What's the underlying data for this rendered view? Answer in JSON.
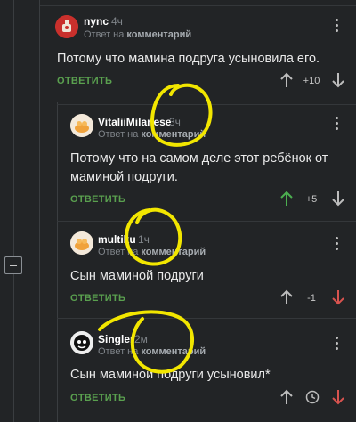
{
  "comments": [
    {
      "author": "nync",
      "time": "4ч",
      "reply_prefix": "Ответ на",
      "reply_target": "комментарий",
      "text": "Потому что мамина подруга усыновила его.",
      "answer_label": "ОТВЕТИТЬ",
      "score": "+10",
      "vote_state": "none"
    },
    {
      "author": "VitaliiMilanese",
      "time": "3ч",
      "reply_prefix": "Ответ на",
      "reply_target": "комментарий",
      "text_line1": "Потому что на самом деле этот ребёнок от",
      "text_line2": "маминой подруги.",
      "answer_label": "ОТВЕТИТЬ",
      "score": "+5",
      "vote_state": "up"
    },
    {
      "author": "multiku",
      "time": "1ч",
      "reply_prefix": "Ответ на",
      "reply_target": "комментарий",
      "text": "Сын маминой подруги",
      "answer_label": "ОТВЕТИТЬ",
      "score": "-1",
      "vote_state": "down"
    },
    {
      "author": "Singler",
      "time": "2м",
      "reply_prefix": "Ответ на",
      "reply_target": "комментарий",
      "text": "Сын маминой подруги усыновил*",
      "answer_label": "ОТВЕТИТЬ",
      "vote_state": "down"
    }
  ],
  "colors": {
    "background": "#222426",
    "answer_green": "#5aa04f",
    "upvote_green": "#4caf50",
    "downvote_red": "#d9534f",
    "highlight_yellow": "#f2e600"
  },
  "icons": {
    "upvote": "arrow-up-icon",
    "downvote": "arrow-down-icon",
    "menu": "more-vertical-icon",
    "pending": "clock-icon",
    "collapse": "collapse-minus-icon"
  }
}
